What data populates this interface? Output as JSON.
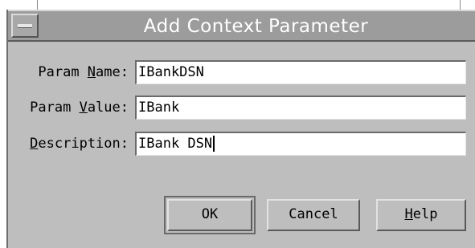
{
  "dialog": {
    "title": "Add Context Parameter"
  },
  "fields": [
    {
      "label_pre": "Param ",
      "label_mnemonic": "N",
      "label_post": "ame:",
      "value": "IBankDSN"
    },
    {
      "label_pre": "Param ",
      "label_mnemonic": "V",
      "label_post": "alue:",
      "value": "IBank"
    },
    {
      "label_pre": "",
      "label_mnemonic": "D",
      "label_post": "escription:",
      "value": "IBank DSN"
    }
  ],
  "buttons": {
    "ok_label": "OK",
    "cancel_label": "Cancel",
    "help_mnemonic": "H",
    "help_rest": "elp"
  }
}
